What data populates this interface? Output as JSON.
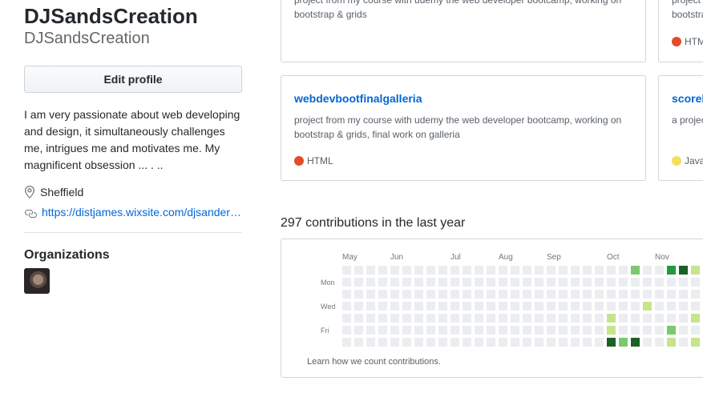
{
  "profile": {
    "name": "DJSandsCreation",
    "login": "DJSandsCreation",
    "edit_label": "Edit profile",
    "bio": "I am very passionate about web developing and design, it simultaneously challenges me, intrigues me and motivates me. My magnificent obsession ... . ..",
    "location": "Sheffield",
    "website": "https://distjames.wixsite.com/djsandersdesign"
  },
  "organizations": {
    "title": "Organizations"
  },
  "repos": [
    {
      "desc_line1": "project from my course with udemy the web developer bootcamp, working on",
      "desc_line2": "bootstrap & grids",
      "lang": "HTML",
      "lang_color": "#e34c26"
    },
    {
      "desc": "project from my course with udemy the web developer bootcamp, working on",
      "lang": "HTM",
      "lang_color": "#e34c26"
    },
    {
      "name": "webdevbootfinalgalleria",
      "desc_line1": "project from my course with udemy the web developer bootcamp, working on",
      "desc_line2": "bootstrap & grids, final work on galleria",
      "lang": "HTML",
      "lang_color": "#e34c26"
    },
    {
      "name": "scorek",
      "desc": "a projec",
      "lang": "Java",
      "lang_color": "#f1e05a"
    }
  ],
  "contributions": {
    "title": "297 contributions in the last year",
    "months": [
      "May",
      "Jun",
      "Jul",
      "Aug",
      "Sep",
      "Oct",
      "Nov"
    ],
    "days": [
      "Mon",
      "Wed",
      "Fri"
    ],
    "learn_link": "Learn how we count contributions.",
    "colors": [
      "#ebedf0",
      "#c6e48b",
      "#7bc96f",
      "#239a3b",
      "#196127"
    ],
    "levels": [
      [
        0,
        0,
        0,
        0,
        0,
        0,
        0
      ],
      [
        0,
        0,
        0,
        0,
        0,
        0,
        0
      ],
      [
        0,
        0,
        0,
        0,
        0,
        0,
        0
      ],
      [
        0,
        0,
        0,
        0,
        0,
        0,
        0
      ],
      [
        0,
        0,
        0,
        0,
        0,
        0,
        0
      ],
      [
        0,
        0,
        0,
        0,
        0,
        0,
        0
      ],
      [
        0,
        0,
        0,
        0,
        0,
        0,
        0
      ],
      [
        0,
        0,
        0,
        0,
        0,
        0,
        0
      ],
      [
        0,
        0,
        0,
        0,
        0,
        0,
        0
      ],
      [
        0,
        0,
        0,
        0,
        0,
        0,
        0
      ],
      [
        0,
        0,
        0,
        0,
        0,
        0,
        0
      ],
      [
        0,
        0,
        0,
        0,
        0,
        0,
        0
      ],
      [
        0,
        0,
        0,
        0,
        0,
        0,
        0
      ],
      [
        0,
        0,
        0,
        0,
        0,
        0,
        0
      ],
      [
        0,
        0,
        0,
        0,
        0,
        0,
        0
      ],
      [
        0,
        0,
        0,
        0,
        0,
        0,
        0
      ],
      [
        0,
        0,
        0,
        0,
        0,
        0,
        0
      ],
      [
        0,
        0,
        0,
        0,
        0,
        0,
        0
      ],
      [
        0,
        0,
        0,
        0,
        0,
        0,
        0
      ],
      [
        0,
        0,
        0,
        0,
        0,
        0,
        0
      ],
      [
        0,
        0,
        0,
        0,
        0,
        0,
        0
      ],
      [
        0,
        0,
        0,
        0,
        0,
        0,
        0
      ],
      [
        0,
        0,
        0,
        0,
        1,
        1,
        4
      ],
      [
        0,
        0,
        0,
        0,
        0,
        0,
        2
      ],
      [
        2,
        0,
        0,
        0,
        0,
        0,
        4
      ],
      [
        0,
        0,
        0,
        1,
        0,
        0,
        0
      ],
      [
        0,
        0,
        0,
        0,
        0,
        0,
        0
      ],
      [
        3,
        0,
        0,
        0,
        0,
        2,
        1
      ],
      [
        4,
        0,
        0,
        0,
        0,
        0,
        0
      ],
      [
        1,
        0,
        0,
        0,
        1,
        0,
        1
      ],
      [
        1,
        0,
        0,
        0,
        0,
        0,
        1
      ]
    ]
  }
}
